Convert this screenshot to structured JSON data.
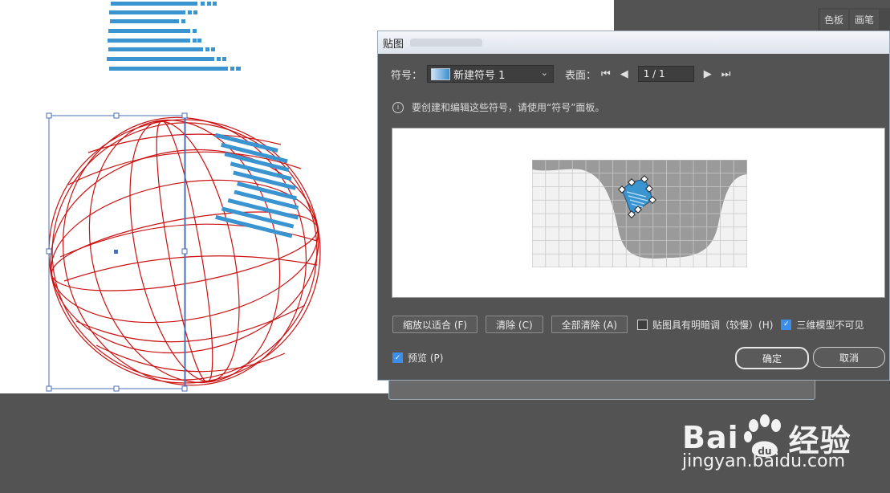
{
  "panel_tabs": [
    "色板",
    "画笔"
  ],
  "dialog": {
    "title": "贴图",
    "symbol_label": "符号：",
    "symbol_value": "新建符号 1",
    "surface_label": "表面：",
    "page_value": "1 / 1",
    "info_text": "要创建和编辑这些符号，请使用“符号”面板。",
    "buttons": {
      "fit": "缩放以适合 (F)",
      "clear": "清除 (C)",
      "clear_all": "全部清除 (A)",
      "ok": "确定",
      "cancel": "取消"
    },
    "checkboxes": {
      "shade_artwork": {
        "label": "贴图具有明暗调（较慢）(H)",
        "checked": false
      },
      "invisible_geometry": {
        "label": "三维模型不可见",
        "checked": true
      },
      "preview": {
        "label": "预览 (P)",
        "checked": true
      }
    }
  },
  "watermark": {
    "brand": "Bai",
    "brand_cn": "经验",
    "url": "jingyan.baidu.com"
  },
  "colors": {
    "artboard": "#ffffff",
    "workspace": "#535353",
    "wireframe": "#cc1111",
    "artwork_blue": "#3a94d0",
    "selection": "#4a6fb5",
    "map_shape": "#9a9a9a"
  }
}
